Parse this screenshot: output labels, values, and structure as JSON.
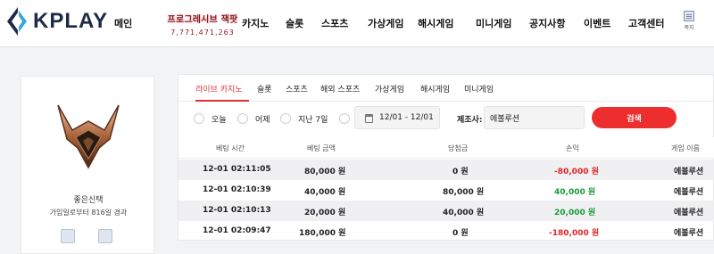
{
  "brand": {
    "name": "KPLAY"
  },
  "nav": {
    "items": [
      "메인",
      "카지노",
      "슬롯",
      "스포츠",
      "가상게임",
      "해시게임",
      "미니게임",
      "공지사항",
      "이벤트",
      "고객센터"
    ],
    "promo_title": "프로그레시브 잭팟",
    "promo_sub": "7,771,471,263",
    "message_label": "쪽지"
  },
  "profile": {
    "name": "좋은신택",
    "elapsed": "가입일로부터 816일 경과"
  },
  "tabs": [
    "라이브 카지노",
    "슬롯",
    "스포츠",
    "해외 스포츠",
    "가상게임",
    "해시게임",
    "미니게임"
  ],
  "filters": {
    "radios": [
      "오늘",
      "어제",
      "지난 7일"
    ],
    "date_range": "12/01 - 12/01",
    "provider_label": "제조사:",
    "provider_value": "에볼루션",
    "search_label": "검색"
  },
  "table": {
    "headers": [
      "베팅 시간",
      "베팅 금액",
      "당첨금",
      "손익",
      "게임 이름"
    ],
    "rows": [
      {
        "time": "12-01 02:11:05",
        "bet": "80,000 원",
        "win": "0 원",
        "profit": "-80,000 원",
        "game": "에볼루션"
      },
      {
        "time": "12-01 02:10:39",
        "bet": "40,000 원",
        "win": "80,000 원",
        "profit": "40,000 원",
        "game": "에볼루션"
      },
      {
        "time": "12-01 02:10:13",
        "bet": "20,000 원",
        "win": "40,000 원",
        "profit": "20,000 원",
        "game": "에볼루션"
      },
      {
        "time": "12-01 02:09:47",
        "bet": "180,000 원",
        "win": "0 원",
        "profit": "-180,000 원",
        "game": "에볼루션"
      }
    ]
  },
  "colors": {
    "accent": "#ee2e2e",
    "negative": "#e02424",
    "positive": "#1a9a3a",
    "brand": "#1e2a4a"
  }
}
